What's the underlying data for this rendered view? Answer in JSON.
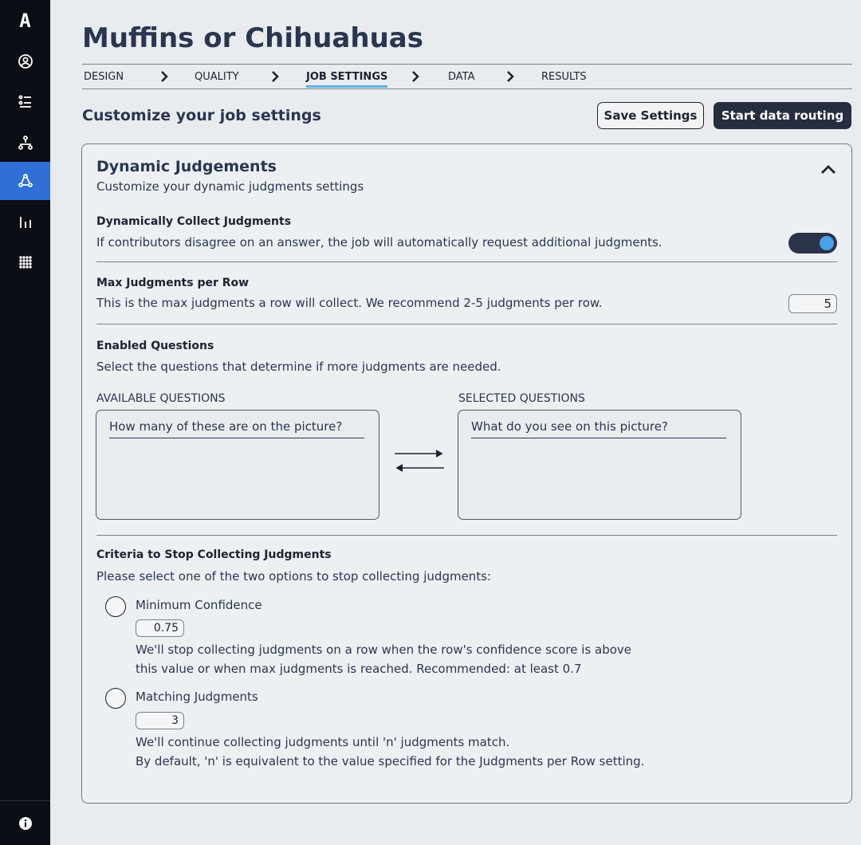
{
  "sidebar": {
    "logo": "A",
    "items": [
      {
        "icon": "user-circle-icon"
      },
      {
        "icon": "list-icon"
      },
      {
        "icon": "hierarchy-icon"
      },
      {
        "icon": "routing-icon",
        "active": true
      },
      {
        "icon": "bar-chart-icon"
      },
      {
        "icon": "grid-icon"
      }
    ],
    "bottom_icon": "info-icon"
  },
  "page": {
    "title": "Muffins or Chihuahuas"
  },
  "breadcrumb": [
    "DESIGN",
    "QUALITY",
    "JOB SETTINGS",
    "DATA",
    "RESULTS"
  ],
  "breadcrumb_active": "JOB SETTINGS",
  "header": {
    "section_title": "Customize your job settings",
    "save_label": "Save Settings",
    "start_label": "Start data routing"
  },
  "card": {
    "title": "Dynamic Judgements",
    "subtitle": "Customize your dynamic judgments settings",
    "dynamic_collect": {
      "label": "Dynamically Collect Judgments",
      "description": "If contributors disagree on an answer, the job will automatically request additional judgments.",
      "enabled": true
    },
    "max_judgments": {
      "label": "Max Judgments per Row",
      "description": "This is the max judgments a row will collect. We recommend 2-5 judgments per row.",
      "value": "5"
    },
    "enabled_questions": {
      "label": "Enabled Questions",
      "description": "Select the questions that determine if more judgments are needed.",
      "available_header": "AVAILABLE QUESTIONS",
      "selected_header": "SELECTED QUESTIONS",
      "available": [
        "How many of these are on the picture?"
      ],
      "selected": [
        "What do you see on this picture?"
      ]
    },
    "criteria": {
      "label": "Criteria to Stop Collecting Judgments",
      "description": "Please select one of the two options to stop collecting judgments:",
      "min_confidence": {
        "label": "Minimum Confidence",
        "value": "0.75",
        "help_1": "We'll stop collecting judgments on a row when the row's confidence score is above",
        "help_2": "this value or when max judgments is reached. Recommended: at least 0.7"
      },
      "matching": {
        "label": "Matching Judgments",
        "value": "3",
        "help_1": "We'll continue collecting judgments until 'n' judgments match.",
        "help_2": "By default, 'n' is equivalent to the value specified for the Judgments per Row setting."
      }
    }
  },
  "colors": {
    "sidebar_bg": "#0b0e14",
    "active_nav": "#2f6fd6",
    "accent_underline": "#5fb0e0",
    "primary_button": "#262d3e",
    "toggle_knob": "#4aa3e8"
  }
}
